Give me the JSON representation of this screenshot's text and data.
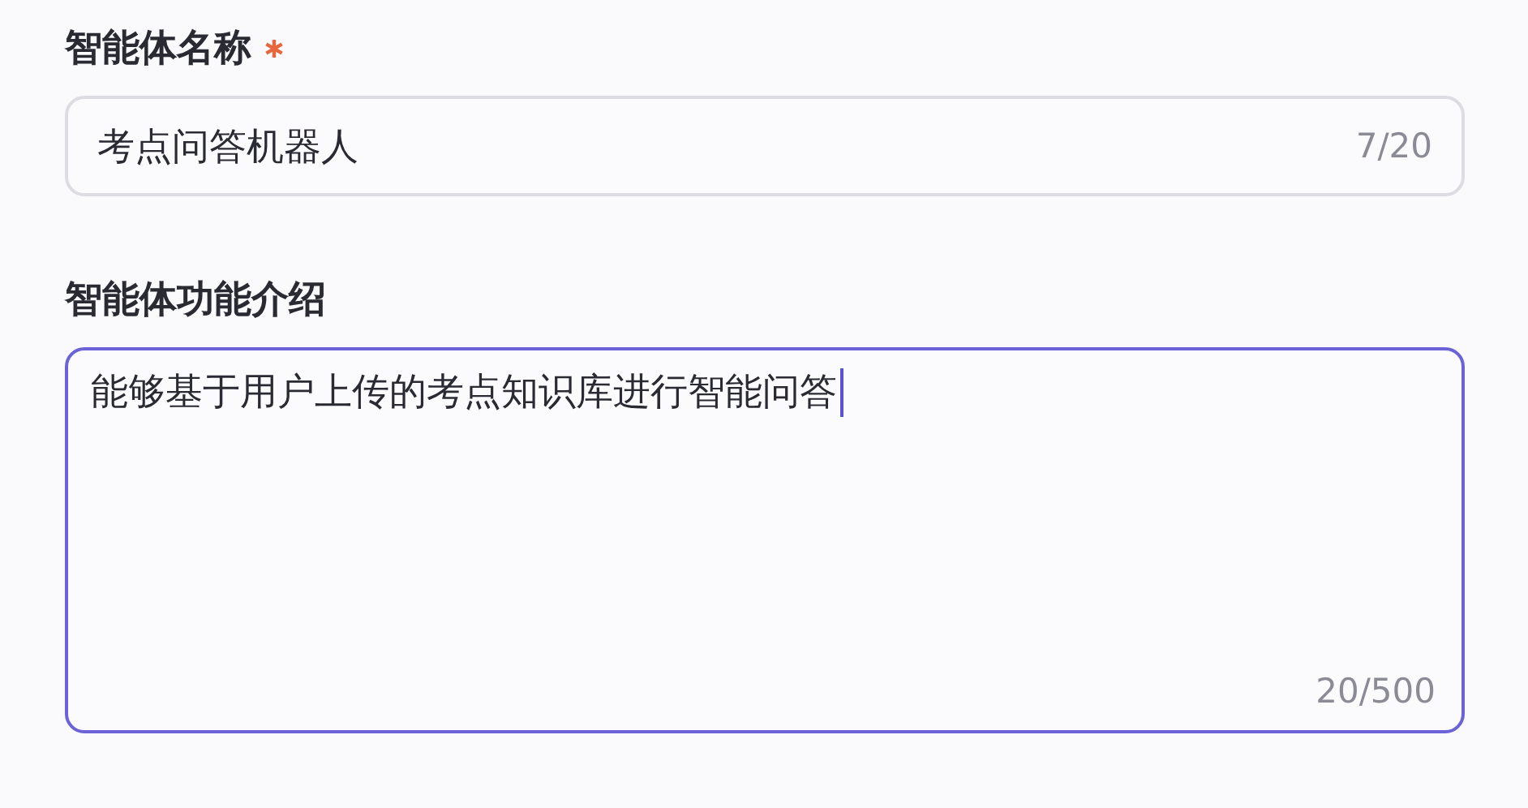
{
  "fields": [
    {
      "kind": "input",
      "label": "智能体名称",
      "required": true,
      "value": "考点问答机器人",
      "counter": "7/20",
      "focused": false
    },
    {
      "kind": "textarea",
      "label": "智能体功能介绍",
      "required": false,
      "value": "能够基于用户上传的考点知识库进行智能问答",
      "counter": "20/500",
      "focused": true
    }
  ]
}
